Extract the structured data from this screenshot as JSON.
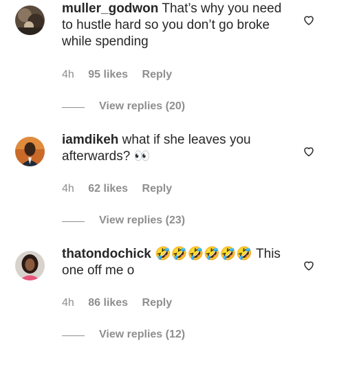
{
  "comments": [
    {
      "username": "muller_godwon",
      "text": "That’s why you need to hustle hard so you don’t go broke while spending",
      "time": "4h",
      "likes": "95 likes",
      "reply": "Reply",
      "view_replies": "View replies (20)",
      "avatar_icon": "avatar-muller-icon"
    },
    {
      "username": "iamdikeh",
      "text": "what if she leaves you afterwards? 👀",
      "time": "4h",
      "likes": "62 likes",
      "reply": "Reply",
      "view_replies": "View replies (23)",
      "avatar_icon": "avatar-iamdikeh-icon"
    },
    {
      "username": "thatondochick",
      "emojis": "🤣🤣🤣🤣🤣🤣",
      "text": "This one off me o",
      "time": "4h",
      "likes": "86 likes",
      "reply": "Reply",
      "view_replies": "View replies (12)",
      "avatar_icon": "avatar-thatondochick-icon"
    }
  ],
  "colors": {
    "text": "#262626",
    "meta": "#8e8e8e",
    "background": "#ffffff"
  }
}
